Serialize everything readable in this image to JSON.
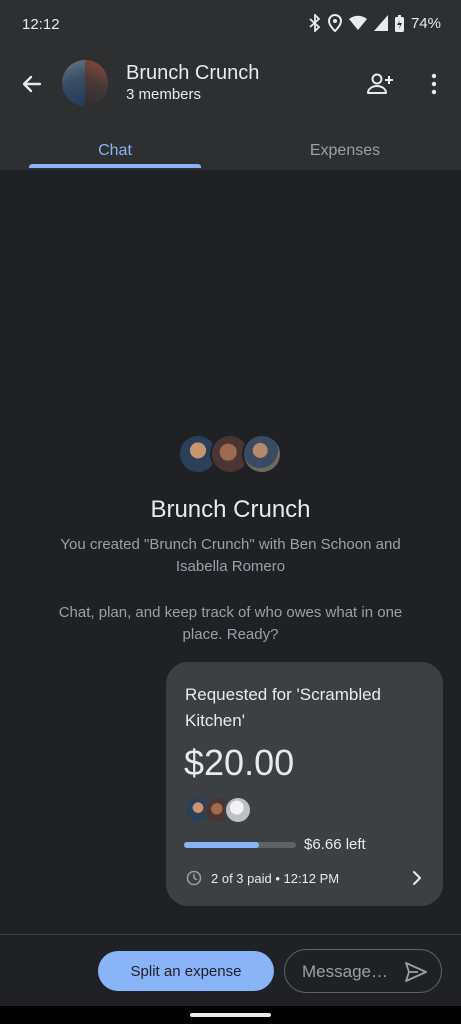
{
  "status_bar": {
    "time": "12:12",
    "battery": "74%",
    "icons": [
      "bluetooth-icon",
      "location-icon",
      "wifi-icon",
      "signal-icon",
      "battery-icon"
    ]
  },
  "header": {
    "title": "Brunch Crunch",
    "subtitle": "3 members",
    "icons": [
      "back-arrow-icon",
      "add-person-icon",
      "more-vert-icon"
    ]
  },
  "tabs": [
    {
      "label": "Chat",
      "active": true
    },
    {
      "label": "Expenses",
      "active": false
    }
  ],
  "intro": {
    "title": "Brunch Crunch",
    "created_text": "You created \"Brunch Crunch\" with Ben Schoon and Isabella Romero",
    "cta_text": "Chat, plan, and keep track of who owes what in one place. Ready?"
  },
  "expense_card": {
    "request": "Requested for 'Scrambled Kitchen'",
    "amount": "$20.00",
    "remaining": "$6.66 left",
    "paid_fraction": 0.667,
    "paid_status": "2 of 3 paid • 12:12 PM"
  },
  "composer": {
    "split_label": "Split an expense",
    "message_placeholder": "Message…"
  },
  "colors": {
    "accent": "#8ab4f8",
    "background": "#202124",
    "surface": "#2d2f31",
    "card": "#3c4043"
  }
}
